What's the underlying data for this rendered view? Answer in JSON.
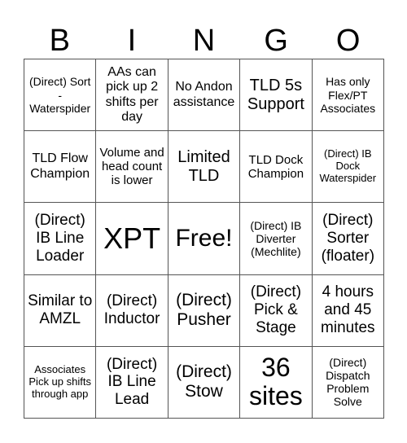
{
  "title_letters": [
    "B",
    "I",
    "N",
    "G",
    "O"
  ],
  "cells": [
    [
      "(Direct) Sort - Waterspider",
      "AAs can pick up 2 shifts per day",
      "No Andon assistance",
      "TLD 5s Support",
      "Has only Flex/PT Associates"
    ],
    [
      "TLD Flow Champion",
      "Volume and head count is lower",
      "Limited TLD",
      "TLD Dock Champion",
      "(Direct) IB Dock Waterspider"
    ],
    [
      "(Direct) IB Line Loader",
      "XPT",
      "Free!",
      "(Direct) IB Diverter (Mechlite)",
      "(Direct) Sorter (floater)"
    ],
    [
      "Similar to AMZL",
      "(Direct) Inductor",
      "(Direct) Pusher",
      "(Direct) Pick & Stage",
      "4 hours and 45 minutes"
    ],
    [
      "Associates Pick up shifts through app",
      "(Direct) IB Line Lead",
      "(Direct) Stow",
      "36 sites",
      "(Direct) Dispatch Problem Solve"
    ]
  ]
}
